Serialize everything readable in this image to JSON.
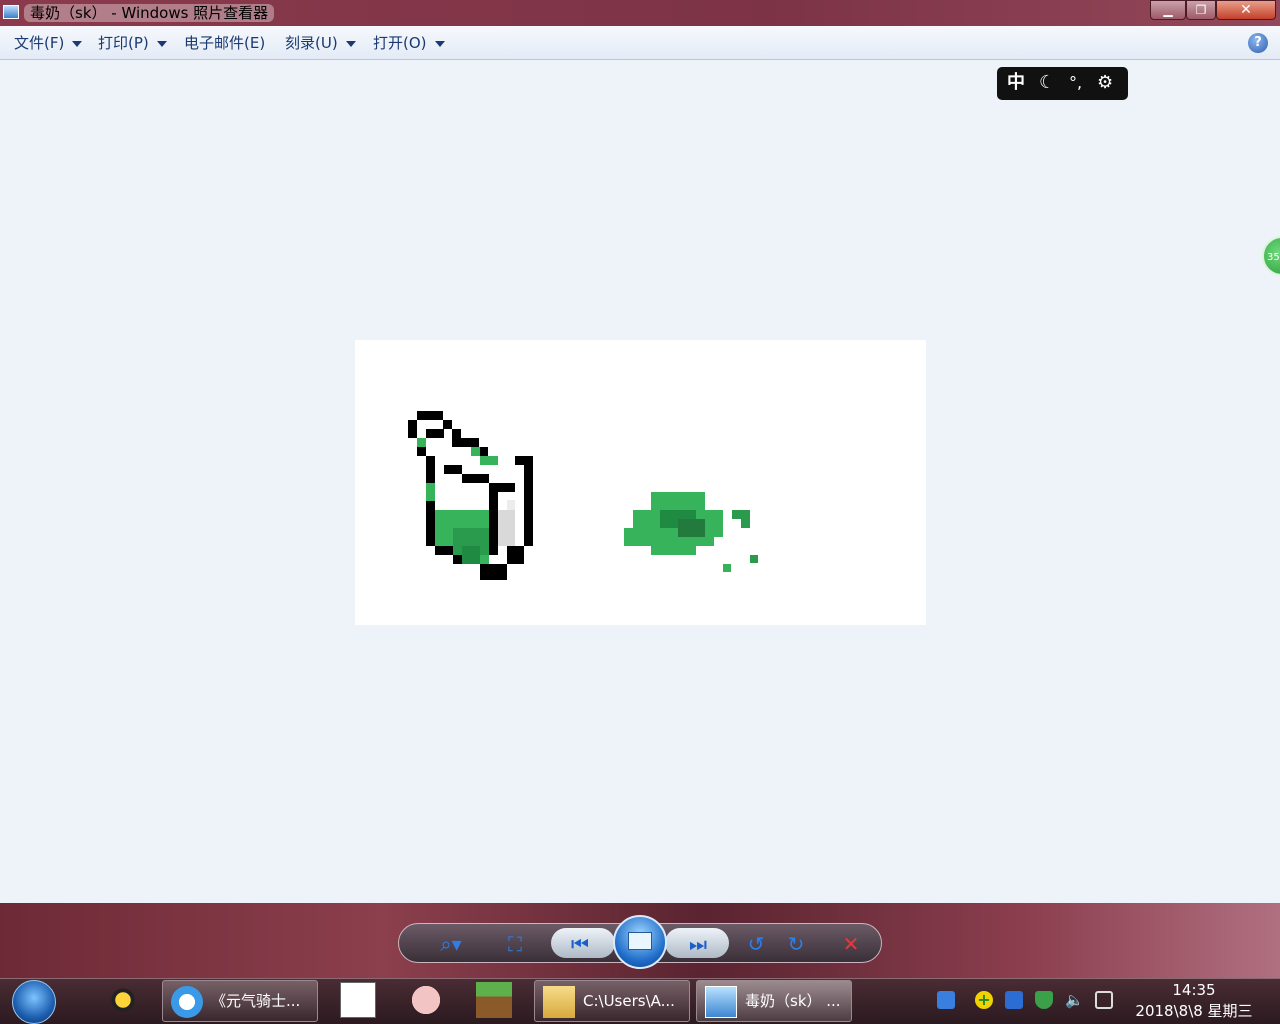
{
  "window": {
    "title": "毒奶（sk） - Windows 照片查看器"
  },
  "menu": [
    {
      "label": "文件(F)",
      "has_dropdown": true
    },
    {
      "label": "打印(P)",
      "has_dropdown": true
    },
    {
      "label": "电子邮件(E)",
      "has_dropdown": false
    },
    {
      "label": "刻录(U)",
      "has_dropdown": true
    },
    {
      "label": "打开(O)",
      "has_dropdown": true
    }
  ],
  "ime": {
    "mode": "中",
    "icons": [
      "moon-icon",
      "punctuation-icon",
      "gear-icon"
    ]
  },
  "float_ball": {
    "value": "35"
  },
  "controls": [
    "zoom-icon",
    "fit-window-icon",
    "previous-icon",
    "slideshow-icon",
    "next-icon",
    "rotate-left-icon",
    "rotate-right-icon",
    "delete-icon"
  ],
  "taskbar": {
    "items": [
      {
        "label": "《元气骑士...",
        "icon": "browser-icon"
      },
      {
        "label": "C:\\Users\\A...",
        "icon": "folder-icon"
      },
      {
        "label": "毒奶（sk） ...",
        "icon": "photo-viewer-icon",
        "active": true
      }
    ],
    "pinned": [
      "qq-icon",
      "calendar-icon",
      "isaac-icon",
      "minecraft-icon"
    ],
    "tray": [
      "network-user-icon",
      "add-icon",
      "display-icon",
      "shield-icon",
      "volume-icon",
      "network-icon"
    ],
    "time": "14:35",
    "date": "2018\\8\\8 星期三"
  },
  "colors": {
    "accent_green": "#34b25a",
    "dark_green": "#1f8a42",
    "titlebar": "#7d3346"
  }
}
